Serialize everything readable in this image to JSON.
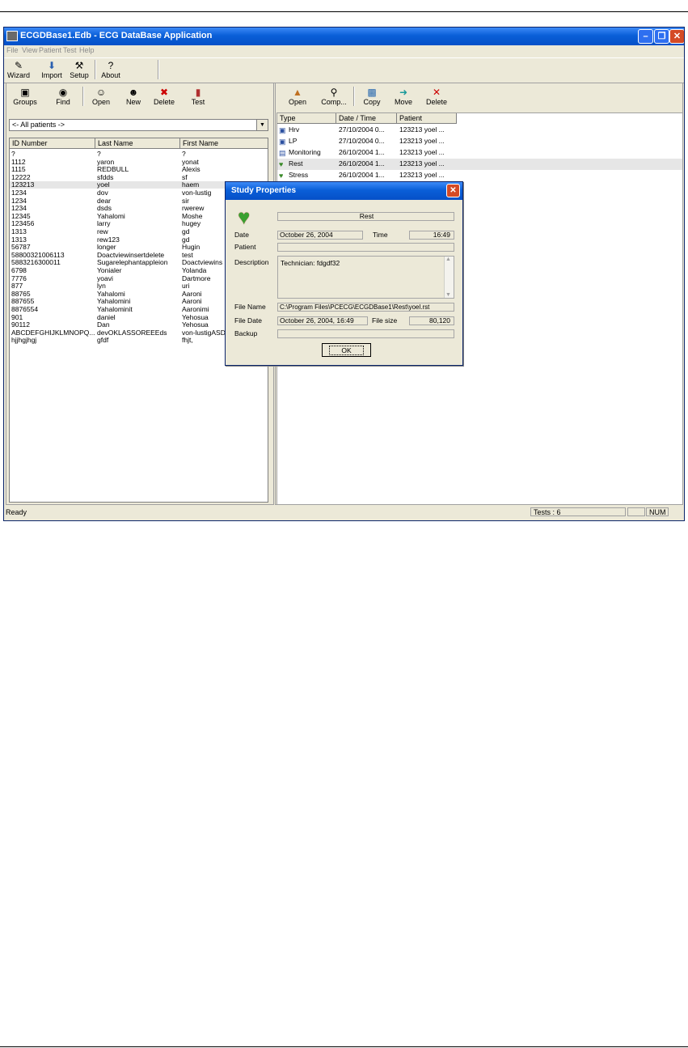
{
  "window": {
    "title": "ECGDBase1.Edb - ECG DataBase Application"
  },
  "menu": [
    "File",
    "View",
    "Patient",
    "Test",
    "Help"
  ],
  "top_toolbar": [
    "Wizard",
    "Import",
    "Setup",
    "About"
  ],
  "left_toolbar": [
    "Groups",
    "Find",
    "Open",
    "New",
    "Delete",
    "Test"
  ],
  "right_toolbar": [
    "Open",
    "Comp...",
    "Copy",
    "Move",
    "Delete"
  ],
  "filter": {
    "value": "<- All patients ->"
  },
  "patients": {
    "columns": [
      "ID Number",
      "Last Name",
      "First Name"
    ],
    "rows": [
      [
        "?",
        "?",
        "?"
      ],
      [
        "1112",
        "yaron",
        "yonat"
      ],
      [
        "1115",
        "REDBULL",
        "Alexis"
      ],
      [
        "12222",
        "sfdds",
        "sf"
      ],
      [
        "123213",
        "yoel",
        "haem"
      ],
      [
        "1234",
        "dov",
        "von-lustig"
      ],
      [
        "1234",
        "dear",
        "sir"
      ],
      [
        "1234",
        "dsds",
        "rwerew"
      ],
      [
        "12345",
        "Yahalomi",
        "Moshe"
      ],
      [
        "123456",
        "larry",
        "hugey"
      ],
      [
        "1313",
        "rew",
        "gd"
      ],
      [
        "1313",
        "rew123",
        "gd"
      ],
      [
        "56787",
        "longer",
        "Hugin"
      ],
      [
        "58800321006113",
        "Doactviewinsertdelete",
        "test"
      ],
      [
        "5883216300011",
        "Sugarelephantappleion",
        "Doactviewins"
      ],
      [
        "6798",
        "Yonialer",
        "Yolanda"
      ],
      [
        "7776",
        "yoavi",
        "Dartmore"
      ],
      [
        "877",
        "lyn",
        "uri"
      ],
      [
        "88765",
        "Yahalomi",
        "Aaroni"
      ],
      [
        "887655",
        "Yahalomini",
        "Aaroni"
      ],
      [
        "8876554",
        "Yahalominit",
        "Aaronimi"
      ],
      [
        "901",
        "daniel",
        "Yehosua"
      ],
      [
        "90112",
        "Dan",
        "Yehosua"
      ],
      [
        "ABCDEFGHIJKLMNOPQ...",
        "devOKLASSOREEEds",
        "von-lustigASD"
      ],
      [
        "hjjhgjhgj",
        "gfdf",
        "fhjt,"
      ]
    ]
  },
  "tests": {
    "columns": [
      "Type",
      "Date / Time",
      "Patient"
    ],
    "rows": [
      {
        "type": "Hrv",
        "date": "27/10/2004 0...",
        "patient": "123213 yoel ...",
        "icon": "hrv-icon"
      },
      {
        "type": "LP",
        "date": "27/10/2004 0...",
        "patient": "123213 yoel ...",
        "icon": "lp-icon"
      },
      {
        "type": "Monitoring",
        "date": "26/10/2004 1...",
        "patient": "123213 yoel ...",
        "icon": "monitor-icon"
      },
      {
        "type": "Rest",
        "date": "26/10/2004 1...",
        "patient": "123213 yoel ...",
        "icon": "heart-icon"
      },
      {
        "type": "Stress",
        "date": "26/10/2004 1...",
        "patient": "123213 yoel ...",
        "icon": "heart-icon"
      }
    ]
  },
  "status": {
    "ready": "Ready",
    "tests": "Tests : 6",
    "num": "NUM"
  },
  "dialog": {
    "title": "Study Properties",
    "type": "Rest",
    "date_label": "Date",
    "date": "October 26, 2004",
    "time_label": "Time",
    "time": "16:49",
    "patient_label": "Patient",
    "patient": "",
    "description_label": "Description",
    "description": "Technician: fdgdf32",
    "filename_label": "File Name",
    "filename": "C:\\Program Files\\PCECG\\ECGDBase1\\Rest\\yoel.rst",
    "filedate_label": "File Date",
    "filedate": "October 26, 2004, 16:49",
    "filesize_label": "File size",
    "filesize": "80,120",
    "backup_label": "Backup",
    "backup": "",
    "ok": "OK"
  }
}
